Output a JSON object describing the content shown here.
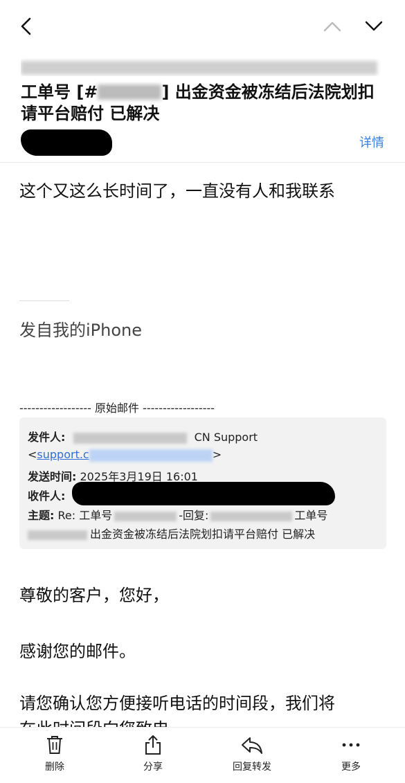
{
  "nav": {
    "back_icon": "chevron-left-icon",
    "prev_icon": "chevron-up-icon",
    "next_icon": "chevron-down-icon"
  },
  "header": {
    "subject_prefix": "工单号 [#",
    "subject_suffix": "] 出金资金被冻结后法院划扣请平台赔付 已解决",
    "details_label": "详情"
  },
  "body": {
    "line1": "这个又这么长时间了，一直没有人和我联系",
    "signature": "发自我的iPhone",
    "original_divider": "------------------ 原始邮件 ------------------"
  },
  "quote": {
    "from_label": "发件人:",
    "from_name": "CN Support",
    "email_prefix": "support.c",
    "email_close": ">",
    "email_open": "<",
    "sent_label": "发送时间:",
    "sent_value": "2025年3月19日 16:01",
    "to_label": "收件人:",
    "subject_label": "主题:",
    "subject_start": "Re: 工单号",
    "subject_mid": "-回复:",
    "subject_end": "工单号",
    "subject_line2": "出金资金被冻结后法院划扣请平台赔付 已解决"
  },
  "reply": {
    "greeting": "尊敬的客户，您好，",
    "thanks": "感谢您的邮件。",
    "request": "请您确认您方便接听电话的时间段，我们将",
    "request_cut": "在此时间段向您致电"
  },
  "toolbar": {
    "delete": "删除",
    "share": "分享",
    "reply_forward": "回复转发",
    "more": "更多"
  }
}
